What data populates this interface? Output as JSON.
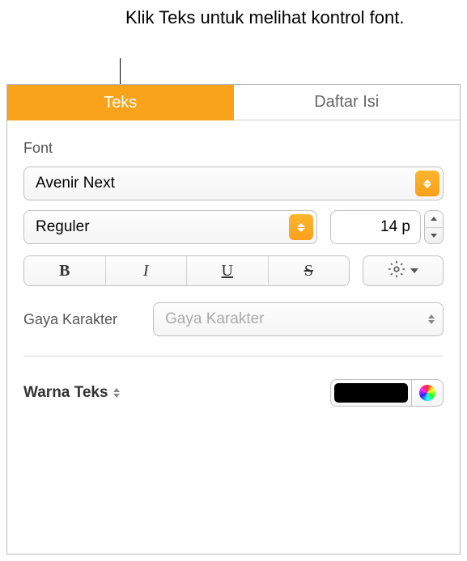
{
  "callout": {
    "text": "Klik Teks untuk melihat kontrol font."
  },
  "tabs": {
    "text": "Teks",
    "toc": "Daftar Isi"
  },
  "font": {
    "section_label": "Font",
    "family": "Avenir Next",
    "style": "Reguler",
    "size": "14 p",
    "bold": "B",
    "italic": "I",
    "underline": "U",
    "strike": "S"
  },
  "char_style": {
    "label": "Gaya Karakter",
    "placeholder": "Gaya Karakter"
  },
  "text_color": {
    "label": "Warna Teks",
    "value": "#000000"
  }
}
